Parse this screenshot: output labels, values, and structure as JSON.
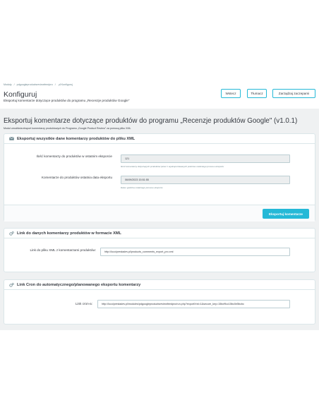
{
  "breadcrumb": {
    "items": [
      "Moduły",
      "/",
      "pdgoogleproductsreviewfeedpro",
      "/"
    ],
    "current": "Konfiguruj"
  },
  "header": {
    "title": "Konfiguruj",
    "subtitle": "Eksportuj komentarze dotyczące produktów do programu „Recenzje produktów Google\""
  },
  "toolbar": {
    "back_label": "Wstecz",
    "translate_label": "Tłumacz",
    "manage_hooks_label": "Zarządzaj zaczepami"
  },
  "module": {
    "title": "Eksportuj komentarze dotyczące produktów do programu „Recenzje produktów Google\" (v1.0.1)",
    "description": "Moduł umożliwia eksport komentarzy produktowych do Programu „Google Product Review\" za pomocą pliku XML"
  },
  "panel_export": {
    "title": "Eksportuj wszystkie dane komentarzy produktów do pliku XML",
    "count_label": "Ilość komentarzy do produktów w ostatnim eksporcie",
    "count_value": "121",
    "count_help": "Ilość komentarzy dotyczących produktów (wraz z wyeksportowanych podczas ostatniego procesu eksportu",
    "date_label": "Komentarze do produktów ostatnia data eksportu",
    "date_value": "06/09/2023 15:51:55",
    "date_help": "Data i godzina ostatniego procesu eksportu",
    "export_button": "Eksportuj komentarze"
  },
  "panel_link": {
    "title": "Link do danych komentarzy produktów w formacie XML",
    "label": "Link do pliku XML z komentarzami produktów:",
    "value": "http://loco/prestadev.pl/products_comments_export_pro.xml"
  },
  "panel_cron": {
    "title": "Link Cron do automatycznego/planowanego eksportu komentarzy",
    "label": "Link cron-a:",
    "value": "http://loco/prestadev.pl/modules/pdgoogleproductsreviewfeedpro/run.php?exportXml=1&secure_key=15bcf9cc15bc0e5bcbc"
  },
  "colors": {
    "accent": "#25b9d7",
    "background": "#eff1f2",
    "text": "#363a41"
  },
  "icons": {
    "export_panel": "envelope-icon",
    "link_panel": "cogs-icon",
    "cron_panel": "cogs-icon"
  }
}
